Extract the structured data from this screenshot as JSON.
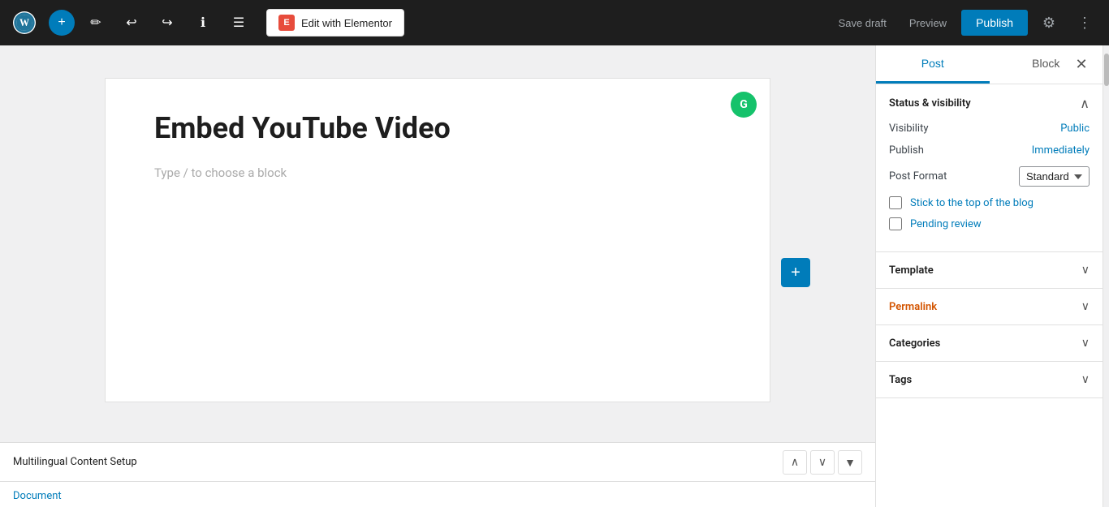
{
  "toolbar": {
    "add_label": "+",
    "elementor_label": "Edit with Elementor",
    "elementor_icon": "E",
    "save_draft_label": "Save draft",
    "preview_label": "Preview",
    "publish_label": "Publish"
  },
  "editor": {
    "post_title": "Embed YouTube Video",
    "block_placeholder": "Type / to choose a block",
    "grammarly_icon": "G"
  },
  "bottom_bar": {
    "multilingual_label": "Multilingual Content Setup",
    "document_link": "Document"
  },
  "sidebar": {
    "tab_post": "Post",
    "tab_block": "Block",
    "status_visibility_title": "Status & visibility",
    "visibility_label": "Visibility",
    "visibility_value": "Public",
    "publish_label": "Publish",
    "publish_value": "Immediately",
    "post_format_label": "Post Format",
    "post_format_value": "Standard",
    "stick_to_top_label": "Stick to the top of the blog",
    "pending_review_label": "Pending review",
    "template_title": "Template",
    "permalink_title": "Permalink",
    "categories_title": "Categories",
    "tags_title": "Tags"
  }
}
